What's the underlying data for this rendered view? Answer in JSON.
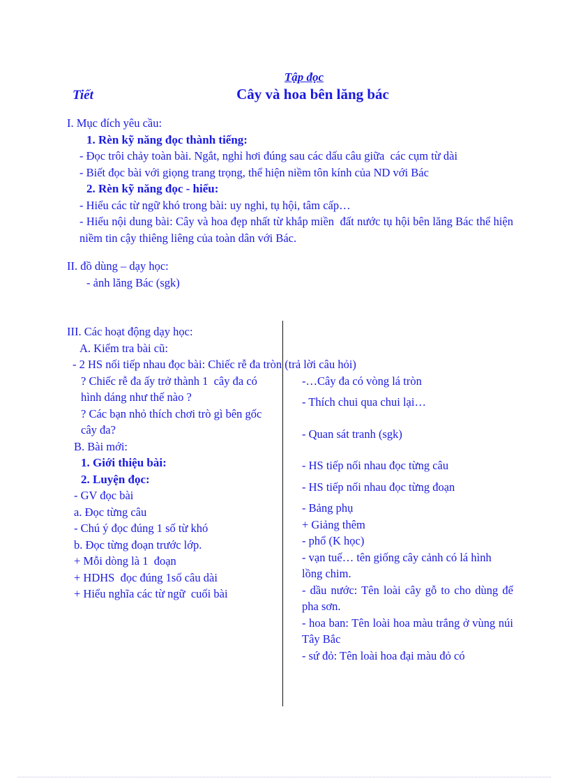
{
  "document": {
    "subject_label": "Tập đọc",
    "period_label": "Tiết",
    "title": "Cây và hoa bên lăng bác"
  },
  "colors": {
    "text": "#1a1ae0",
    "divider": "#111111",
    "footer_rule": "#b9bede"
  },
  "section_objectives": {
    "heading": "I. Mục đích yêu cầu:",
    "sub1_heading": "1. Rèn kỹ năng đọc thành tiếng:",
    "sub1_items": [
      "- Đọc trôi chảy toàn bài. Ngắt, nghỉ hơi đúng sau các dấu câu giữa  các cụm từ dài",
      "- Biết đọc bài với giọng trang trọng, thể hiện niềm tôn kính của ND với Bác"
    ],
    "sub2_heading": "2. Rèn kỹ năng đọc - hiểu:",
    "sub2_items": [
      "- Hiểu các từ ngữ khó trong bài: uy nghi, tụ hội, tâm cấp…",
      "- Hiểu nội dung bài: Cây và hoa đẹp nhất từ khắp miền  đất nước tụ hội bên lăng Bác thể hiện niềm tin cậy thiêng liêng của toàn dân với Bác."
    ]
  },
  "section_materials": {
    "heading": "II. đồ dùng – dạy học:",
    "items": [
      "- ảnh lăng Bác (sgk)"
    ]
  },
  "section_activities": {
    "heading": "III. Các hoạt động dạy học:",
    "part_a_heading": "A. Kiểm tra bài cũ:",
    "part_a_full_line": "- 2 HS nối tiếp nhau đọc bài: Chiếc rễ đa tròn (trả lời câu hỏi)",
    "rows": [
      {
        "left": "? Chiếc rễ đa ấy trở thành 1  cây đa có hình dáng như thế nào ?",
        "right": "-…Cây đa có vòng lá tròn",
        "left_bold": false,
        "right_bold": false
      },
      {
        "left": "? Các bạn nhỏ thích chơi trò gì bên gốc cây đa?",
        "right": "- Thích chui qua chui lại…",
        "left_bold": false,
        "right_bold": false
      },
      {
        "left": "B. Bài mới:",
        "right": "",
        "left_bold": false,
        "right_bold": false
      },
      {
        "left": "1. Giới thiệu bài:",
        "right": "- Quan sát tranh (sgk)",
        "left_bold": true,
        "right_bold": false
      },
      {
        "left": "2. Luyện đọc:",
        "right": "",
        "left_bold": true,
        "right_bold": false
      },
      {
        "left": "- GV đọc bài",
        "right": "",
        "left_bold": false,
        "right_bold": false
      },
      {
        "left": "a. Đọc từng câu",
        "right": "- HS tiếp nối nhau đọc từng câu",
        "left_bold": false,
        "right_bold": false
      },
      {
        "left": "- Chú ý đọc đúng 1 số từ khó",
        "right": "",
        "left_bold": false,
        "right_bold": false
      },
      {
        "left": "b. Đọc từng đoạn trước lớp.",
        "right": "- HS tiếp nối nhau đọc từng đoạn",
        "left_bold": false,
        "right_bold": false
      },
      {
        "left": "+ Mỗi dòng là 1  đoạn",
        "right": "",
        "left_bold": false,
        "right_bold": false
      },
      {
        "left": "+ HDHS  đọc đúng 1số câu dài",
        "right": "- Bảng phụ",
        "left_bold": false,
        "right_bold": false
      },
      {
        "left": "+ Hiểu nghĩa các từ ngữ  cuối bài",
        "right": "+ Giảng thêm",
        "left_bold": false,
        "right_bold": false
      },
      {
        "left": "",
        "right": "- phổ (K học)",
        "left_bold": false,
        "right_bold": false
      },
      {
        "left": "",
        "right": "- vạn tuế… tên giống cây cảnh có lá hình lồng chim.",
        "left_bold": false,
        "right_bold": false
      },
      {
        "left": "",
        "right": "- dầu nước: Tên loài cây gỗ to cho dùng để pha sơn.",
        "left_bold": false,
        "right_bold": false
      },
      {
        "left": "",
        "right": "- hoa ban: Tên loài hoa màu trắng ở vùng núi Tây Bắc",
        "left_bold": false,
        "right_bold": false
      },
      {
        "left": "",
        "right": "- sứ đỏ: Tên loài hoa đại màu đỏ có",
        "left_bold": false,
        "right_bold": false
      }
    ]
  }
}
